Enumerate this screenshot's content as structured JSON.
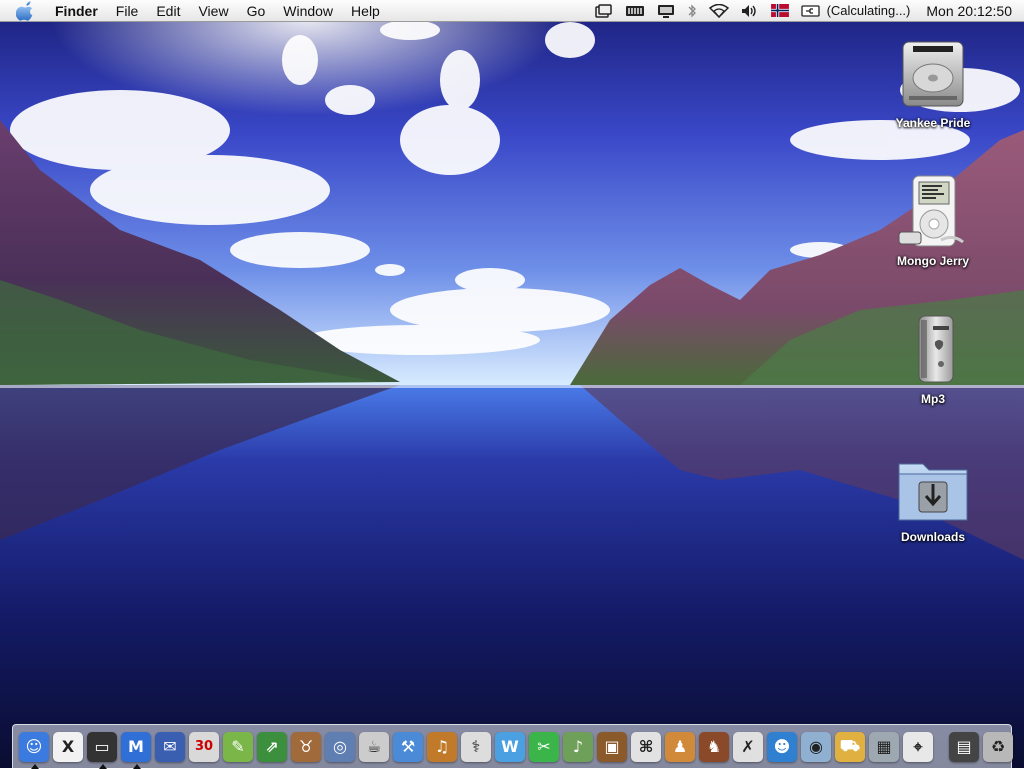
{
  "menubar": {
    "app_name": "Finder",
    "menus": [
      "File",
      "Edit",
      "View",
      "Go",
      "Window",
      "Help"
    ],
    "battery_text": "(Calculating...)",
    "clock": "Mon 20:12:50",
    "status_icons": [
      "window-icon",
      "battery-meter-icon",
      "display-icon",
      "bluetooth-icon",
      "wifi-icon",
      "volume-icon",
      "norway-flag-icon",
      "power-plug-icon"
    ]
  },
  "desktop": {
    "icons": [
      {
        "label": "Yankee Pride",
        "icon": "hard-drive-icon"
      },
      {
        "label": "Mongo Jerry",
        "icon": "ipod-icon"
      },
      {
        "label": "Mp3",
        "icon": "power-mac-g4-icon"
      },
      {
        "label": "Downloads",
        "icon": "downloads-folder-icon"
      }
    ]
  },
  "dock": {
    "calendar_day": "30",
    "items": [
      {
        "name": "finder",
        "glyph": "☺",
        "color": "#3b7be0",
        "running": true
      },
      {
        "name": "x11",
        "glyph": "X",
        "color": "#f2f2f2",
        "running": false
      },
      {
        "name": "terminal",
        "glyph": "▭",
        "color": "#333333",
        "running": true
      },
      {
        "name": "mail-app",
        "glyph": "M",
        "color": "#2f6fd6",
        "running": true
      },
      {
        "name": "thunderbird",
        "glyph": "✉",
        "color": "#3a5fb0",
        "running": false
      },
      {
        "name": "ical",
        "glyph": "30",
        "color": "#d9d9d9",
        "running": false
      },
      {
        "name": "paintbrush",
        "glyph": "✎",
        "color": "#7ab648",
        "running": false
      },
      {
        "name": "stock-monitor",
        "glyph": "⇗",
        "color": "#3c8f3c",
        "running": false
      },
      {
        "name": "gnu",
        "glyph": "♉",
        "color": "#a06a3a",
        "running": false
      },
      {
        "name": "preview",
        "glyph": "◎",
        "color": "#5f7fb3",
        "running": false
      },
      {
        "name": "coffee",
        "glyph": "☕",
        "color": "#cccccc",
        "running": false
      },
      {
        "name": "xcode",
        "glyph": "⚒",
        "color": "#4a8ad6",
        "running": false
      },
      {
        "name": "guitar",
        "glyph": "♫",
        "color": "#c07a2a",
        "running": false
      },
      {
        "name": "disk-utility",
        "glyph": "⚕",
        "color": "#dddddd",
        "running": false
      },
      {
        "name": "wire-app",
        "glyph": "W",
        "color": "#4aa0e0",
        "running": false
      },
      {
        "name": "scissors",
        "glyph": "✂",
        "color": "#3bb54a",
        "running": false
      },
      {
        "name": "itunes",
        "glyph": "♪",
        "color": "#6fa05a",
        "running": false
      },
      {
        "name": "iphoto",
        "glyph": "▣",
        "color": "#8b5a2b",
        "running": false
      },
      {
        "name": "apple-dialog",
        "glyph": "⌘",
        "color": "#e2e2e2",
        "running": false
      },
      {
        "name": "people",
        "glyph": "♟",
        "color": "#d08a3a",
        "running": false
      },
      {
        "name": "game-character",
        "glyph": "♞",
        "color": "#8a4a2a",
        "running": false
      },
      {
        "name": "crossover",
        "glyph": "✗",
        "color": "#e0e0e0",
        "running": false
      },
      {
        "name": "ichat",
        "glyph": "☻",
        "color": "#2f80d0",
        "running": false
      },
      {
        "name": "safari",
        "glyph": "◉",
        "color": "#8fb0d0",
        "running": false
      },
      {
        "name": "transmit",
        "glyph": "⛟",
        "color": "#e0b040",
        "running": false
      },
      {
        "name": "network-window",
        "glyph": "▦",
        "color": "#9ea8b0",
        "running": false
      },
      {
        "name": "map-app",
        "glyph": "⌖",
        "color": "#e8e8e8",
        "running": false
      },
      {
        "name": "minimized-window",
        "glyph": "▤",
        "color": "#444444",
        "running": false
      },
      {
        "name": "trash",
        "glyph": "♻",
        "color": "#b8b8b8",
        "running": false
      }
    ]
  }
}
